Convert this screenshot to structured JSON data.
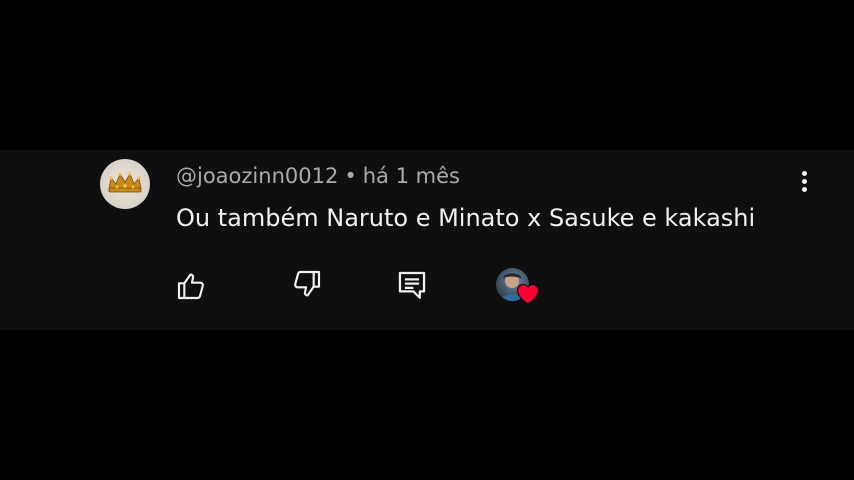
{
  "comment": {
    "username": "@joaozinn0012",
    "separator": "•",
    "timestamp": "há 1 mês",
    "text": "Ou também Naruto e Minato x Sasuke e kakashi",
    "avatar_icon": "crown-icon",
    "heart_color": "#ff0033"
  },
  "actions": {
    "like_icon": "thumb-up-icon",
    "dislike_icon": "thumb-down-icon",
    "reply_icon": "comment-reply-icon",
    "creator_heart_icon": "heart-icon",
    "more_icon": "more-vertical-icon"
  }
}
